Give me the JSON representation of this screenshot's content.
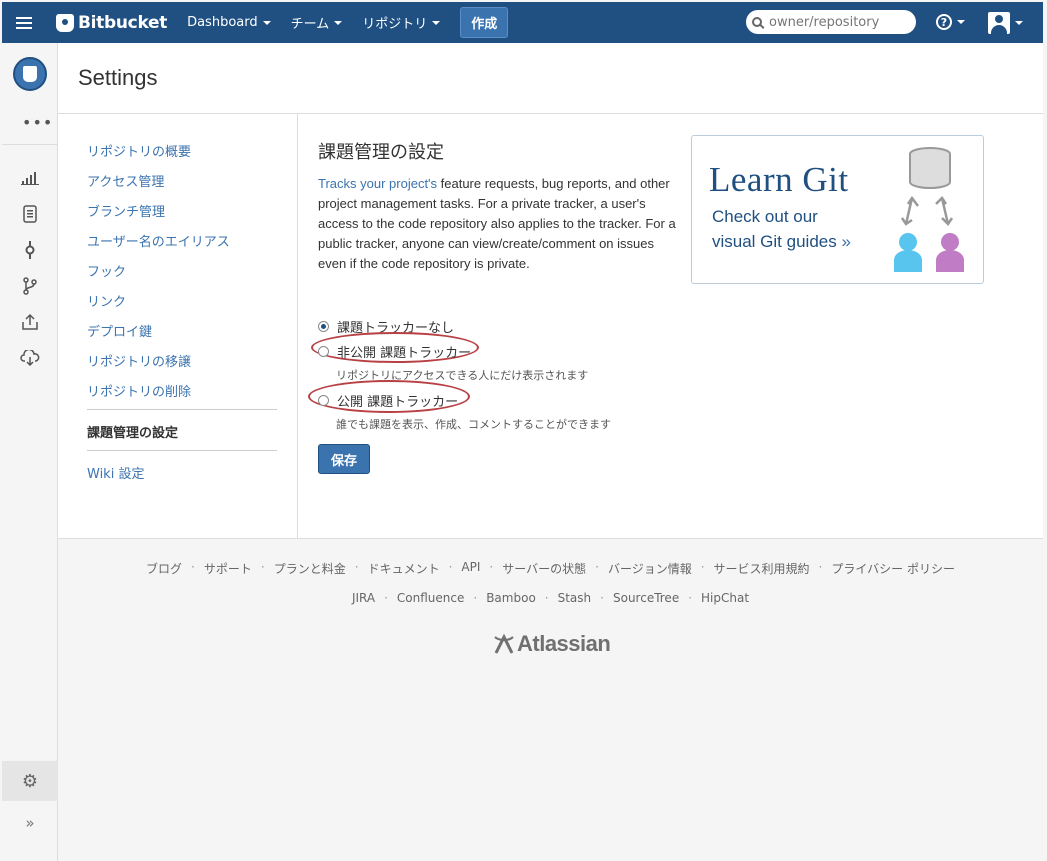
{
  "topbar": {
    "logo": "Bitbucket",
    "nav": [
      "Dashboard",
      "チーム",
      "リポジトリ"
    ],
    "create_label": "作成",
    "search_placeholder": "owner/repository",
    "help_glyph": "?"
  },
  "sidebar": {
    "icons": [
      "stats-icon",
      "source-icon",
      "commits-icon",
      "branches-icon",
      "pull-requests-icon",
      "downloads-icon"
    ]
  },
  "page": {
    "title": "Settings"
  },
  "settings_nav": {
    "links": [
      "リポジトリの概要",
      "アクセス管理",
      "ブランチ管理",
      "ユーザー名のエイリアス",
      "フック",
      "リンク",
      "デプロイ鍵",
      "リポジトリの移譲",
      "リポジトリの削除"
    ],
    "current": "課題管理の設定",
    "wiki": "Wiki 設定"
  },
  "issue_settings": {
    "title": "課題管理の設定",
    "desc_link": "Tracks your project's",
    "desc_rest": " feature requests, bug reports, and other project management tasks. For a private tracker, a user's access to the code repository also applies to the tracker. For a public tracker, anyone can view/create/comment on issues even if the code repository is private.",
    "options": [
      {
        "label": "課題トラッカーなし",
        "hint": "",
        "checked": true
      },
      {
        "label": "非公開 課題トラッカー",
        "hint": "リポジトリにアクセスできる人にだけ表示されます",
        "checked": false
      },
      {
        "label": "公開 課題トラッカー",
        "hint": "誰でも課題を表示、作成、コメントすることができます",
        "checked": false
      }
    ],
    "save_label": "保存"
  },
  "promo": {
    "title": "Learn Git",
    "line1": "Check out our",
    "line2": "visual Git guides",
    "arrow": "»"
  },
  "footer": {
    "links": [
      "ブログ",
      "サポート",
      "プランと料金",
      "ドキュメント",
      "API",
      "サーバーの状態",
      "バージョン情報",
      "サービス利用規約",
      "プライバシー ポリシー"
    ],
    "links2": [
      "JIRA",
      "Confluence",
      "Bamboo",
      "Stash",
      "SourceTree",
      "HipChat"
    ],
    "brand": "Atlassian"
  }
}
